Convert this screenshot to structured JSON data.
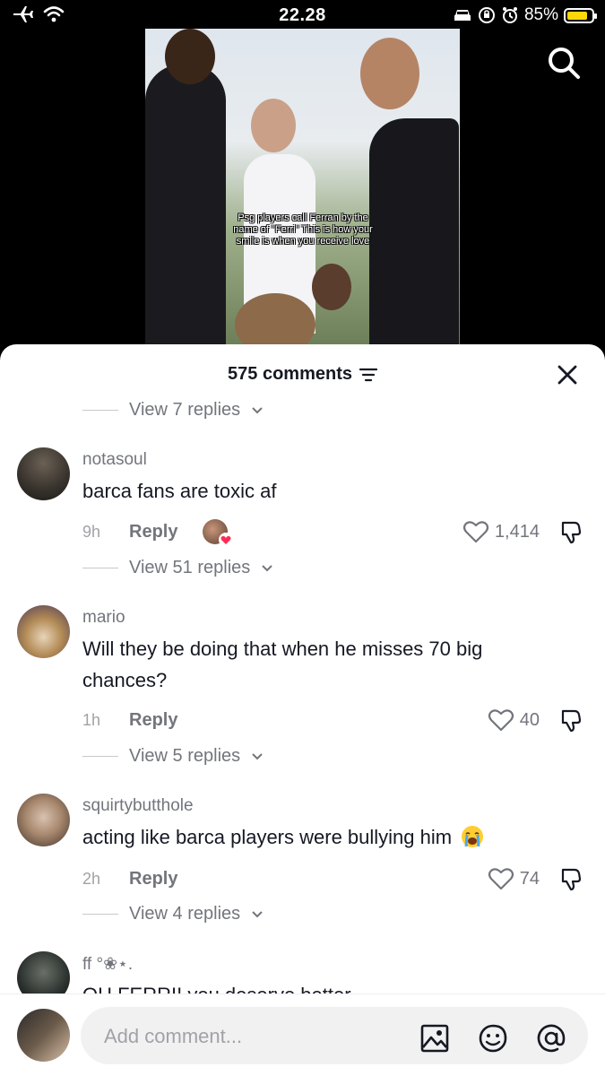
{
  "status_bar": {
    "time": "22.28",
    "battery": "85%",
    "battery_fraction": 0.85,
    "icons": [
      "airplane-icon",
      "wifi-icon",
      "car-icon",
      "orientation-lock-icon",
      "alarm-icon",
      "battery-icon"
    ]
  },
  "video": {
    "caption": "Psg players call Ferran by the name of \"Ferri\" This is how your smile is when you receive love",
    "search_icon": "search-icon"
  },
  "sheet": {
    "count_label": "575 comments",
    "filter_icon": "filter-icon",
    "close_icon": "close-icon"
  },
  "top_replies": {
    "label": "View 7 replies"
  },
  "comments": [
    {
      "username": "notasoul",
      "text": "barca fans are toxic af",
      "time": "9h",
      "reply_label": "Reply",
      "likes": "1,414",
      "author_liked": true,
      "replies_label": "View 51 replies"
    },
    {
      "username": "mario",
      "text": "Will they be doing that when he misses 70 big chances?",
      "time": "1h",
      "reply_label": "Reply",
      "likes": "40",
      "replies_label": "View 5 replies"
    },
    {
      "username": "squirtybutthole",
      "text": "acting like barca players were bullying him",
      "emoji": "loudly-crying-face",
      "time": "2h",
      "reply_label": "Reply",
      "likes": "74",
      "replies_label": "View 4 replies"
    },
    {
      "username": "ff °❀⋆.",
      "text": "OH FERRI! you deserve better"
    }
  ],
  "composer": {
    "placeholder": "Add comment...",
    "icons": [
      "image-icon",
      "emoji-icon",
      "mention-icon"
    ]
  },
  "colors": {
    "accent_heart": "#fe2c55",
    "battery": "#ffd60a",
    "text_primary": "#161823",
    "text_secondary": "#73757c"
  }
}
